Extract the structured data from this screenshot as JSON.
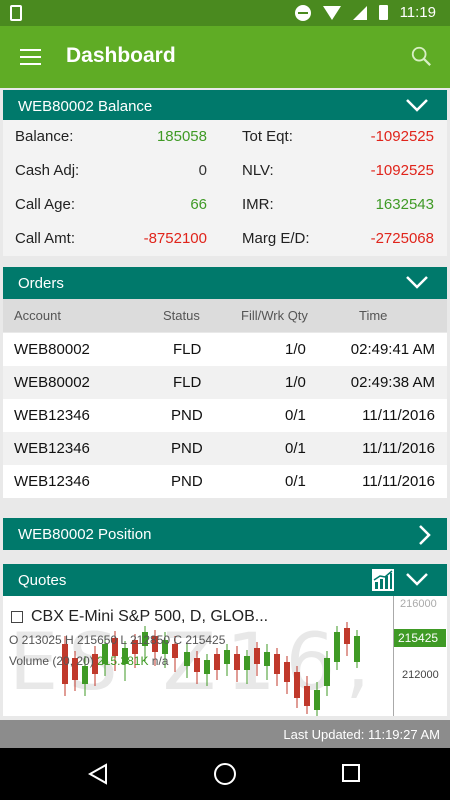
{
  "status_bar": {
    "time": "11:19"
  },
  "app_bar": {
    "title": "Dashboard"
  },
  "balance_panel": {
    "title": "WEB80002 Balance",
    "rows": [
      {
        "label1": "Balance:",
        "value1": "185058",
        "label2": "Tot Eqt:",
        "value2": "-1092525"
      },
      {
        "label1": "Cash Adj:",
        "value1": "0",
        "label2": "NLV:",
        "value2": "-1092525"
      },
      {
        "label1": "Call Age:",
        "value1": "66",
        "label2": "IMR:",
        "value2": "1632543"
      },
      {
        "label1": "Call Amt:",
        "value1": "-8752100",
        "label2": "Marg E/D:",
        "value2": "-2725068"
      }
    ]
  },
  "orders_panel": {
    "title": "Orders",
    "columns": {
      "account": "Account",
      "status": "Status",
      "qty": "Fill/Wrk Qty",
      "time": "Time"
    },
    "rows": [
      {
        "account": "WEB80002",
        "status": "FLD",
        "qty": "1/0",
        "time": "02:49:41 AM"
      },
      {
        "account": "WEB80002",
        "status": "FLD",
        "qty": "1/0",
        "time": "02:49:38 AM"
      },
      {
        "account": "WEB12346",
        "status": "PND",
        "qty": "0/1",
        "time": "11/11/2016"
      },
      {
        "account": "WEB12346",
        "status": "PND",
        "qty": "0/1",
        "time": "11/11/2016"
      },
      {
        "account": "WEB12346",
        "status": "PND",
        "qty": "0/1",
        "time": "11/11/2016"
      }
    ]
  },
  "position_panel": {
    "title": "WEB80002 Position"
  },
  "quotes_panel": {
    "title": "Quotes",
    "chart": {
      "watermark": "ES Z16, D",
      "title": "CBX E-Mini S&P 500, D, GLOB...",
      "ohlc": "O 213025  H 215650  L 212850  C 215425",
      "volume_label": "Volume (20, 20)",
      "volume_value": "215.381K",
      "volume_na": "n/a",
      "axis_top": "216000",
      "current_price": "215425",
      "axis_mid": "212000"
    }
  },
  "footer": {
    "last_updated": "Last Updated: 11:19:27 AM"
  },
  "colors": {
    "status_bar": "#4a8a1f",
    "app_bar": "#5fac25",
    "panel_header": "#00796b",
    "positive": "#3f9a25",
    "negative": "#e0241b"
  }
}
